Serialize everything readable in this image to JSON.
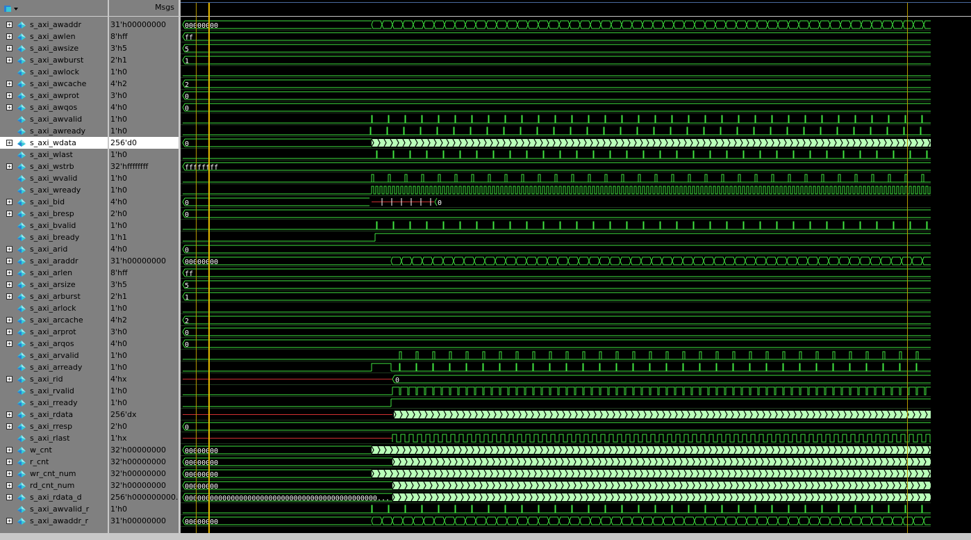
{
  "header": {
    "msgs_label": "Msgs",
    "logo_icon": "wave-window-icon"
  },
  "signals": [
    {
      "name": "s_axi_awaddr",
      "value": "31'h00000000",
      "bus": true,
      "wave": {
        "type": "bus",
        "init": "00000000",
        "activeStart": 535,
        "dense": "medium",
        "color": "#3fe43f"
      }
    },
    {
      "name": "s_axi_awlen",
      "value": "8'hff",
      "bus": true,
      "wave": {
        "type": "const",
        "init": "ff"
      }
    },
    {
      "name": "s_axi_awsize",
      "value": "3'h5",
      "bus": true,
      "wave": {
        "type": "const",
        "init": "5"
      }
    },
    {
      "name": "s_axi_awburst",
      "value": "2'h1",
      "bus": true,
      "wave": {
        "type": "const",
        "init": "1"
      }
    },
    {
      "name": "s_axi_awlock",
      "value": "1'h0",
      "bus": false,
      "wave": {
        "type": "low"
      }
    },
    {
      "name": "s_axi_awcache",
      "value": "4'h2",
      "bus": true,
      "wave": {
        "type": "const",
        "init": "2"
      }
    },
    {
      "name": "s_axi_awprot",
      "value": "3'h0",
      "bus": true,
      "wave": {
        "type": "const",
        "init": "0"
      }
    },
    {
      "name": "s_axi_awqos",
      "value": "4'h0",
      "bus": true,
      "wave": {
        "type": "const",
        "init": "0"
      }
    },
    {
      "name": "s_axi_awvalid",
      "value": "1'h0",
      "bus": false,
      "wave": {
        "type": "pulses",
        "start": 535,
        "period": 24
      }
    },
    {
      "name": "s_axi_awready",
      "value": "1'h0",
      "bus": false,
      "wave": {
        "type": "pulses",
        "start": 533,
        "period": 24
      }
    },
    {
      "name": "s_axi_wdata",
      "value": "256'd0",
      "bus": true,
      "selected": true,
      "wave": {
        "type": "bus",
        "init": "0",
        "activeStart": 535,
        "dense": "heavy",
        "color": "#b9ffb9"
      }
    },
    {
      "name": "s_axi_wlast",
      "value": "1'h0",
      "bus": false,
      "wave": {
        "type": "pulses",
        "start": 542,
        "period": 24
      }
    },
    {
      "name": "s_axi_wstrb",
      "value": "32'hffffffff",
      "bus": true,
      "wave": {
        "type": "const",
        "init": "ffffffff"
      }
    },
    {
      "name": "s_axi_wvalid",
      "value": "1'h0",
      "bus": false,
      "wave": {
        "type": "pulses",
        "start": 535,
        "period": 24,
        "wide": true
      }
    },
    {
      "name": "s_axi_wready",
      "value": "1'h0",
      "bus": false,
      "wave": {
        "type": "clock",
        "start": 535,
        "period": 6
      }
    },
    {
      "name": "s_axi_bid",
      "value": "4'h0",
      "bus": true,
      "wave": {
        "type": "bid",
        "init": "0"
      }
    },
    {
      "name": "s_axi_bresp",
      "value": "2'h0",
      "bus": true,
      "wave": {
        "type": "const",
        "init": "0"
      }
    },
    {
      "name": "s_axi_bvalid",
      "value": "1'h0",
      "bus": false,
      "wave": {
        "type": "pulses",
        "start": 542,
        "period": 24
      }
    },
    {
      "name": "s_axi_bready",
      "value": "1'h1",
      "bus": false,
      "wave": {
        "type": "high"
      }
    },
    {
      "name": "s_axi_arid",
      "value": "4'h0",
      "bus": true,
      "wave": {
        "type": "const",
        "init": "0"
      }
    },
    {
      "name": "s_axi_araddr",
      "value": "31'h00000000",
      "bus": true,
      "wave": {
        "type": "bus",
        "init": "00000000",
        "activeStart": 563,
        "dense": "medium",
        "color": "#3fe43f"
      }
    },
    {
      "name": "s_axi_arlen",
      "value": "8'hff",
      "bus": true,
      "wave": {
        "type": "const",
        "init": "ff"
      }
    },
    {
      "name": "s_axi_arsize",
      "value": "3'h5",
      "bus": true,
      "wave": {
        "type": "const",
        "init": "5"
      }
    },
    {
      "name": "s_axi_arburst",
      "value": "2'h1",
      "bus": true,
      "wave": {
        "type": "const",
        "init": "1"
      }
    },
    {
      "name": "s_axi_arlock",
      "value": "1'h0",
      "bus": false,
      "wave": {
        "type": "low"
      }
    },
    {
      "name": "s_axi_arcache",
      "value": "4'h2",
      "bus": true,
      "wave": {
        "type": "const",
        "init": "2"
      }
    },
    {
      "name": "s_axi_arprot",
      "value": "3'h0",
      "bus": true,
      "wave": {
        "type": "const",
        "init": "0"
      }
    },
    {
      "name": "s_axi_arqos",
      "value": "4'h0",
      "bus": true,
      "wave": {
        "type": "const",
        "init": "0"
      }
    },
    {
      "name": "s_axi_arvalid",
      "value": "1'h0",
      "bus": false,
      "wave": {
        "type": "pulses",
        "start": 575,
        "period": 24,
        "wide": true
      }
    },
    {
      "name": "s_axi_arready",
      "value": "1'h0",
      "bus": false,
      "wave": {
        "type": "arready",
        "start": 575,
        "period": 24
      }
    },
    {
      "name": "s_axi_rid",
      "value": "4'hx",
      "bus": true,
      "wave": {
        "type": "xbus",
        "switch": 565,
        "init": "0"
      }
    },
    {
      "name": "s_axi_rvalid",
      "value": "1'h0",
      "bus": false,
      "wave": {
        "type": "rvalid",
        "start": 565,
        "period": 12
      }
    },
    {
      "name": "s_axi_rready",
      "value": "1'h0",
      "bus": false,
      "wave": {
        "type": "risehigh",
        "start": 563
      }
    },
    {
      "name": "s_axi_rdata",
      "value": "256'dx",
      "bus": true,
      "wave": {
        "type": "xdata",
        "switch": 565
      }
    },
    {
      "name": "s_axi_rresp",
      "value": "2'h0",
      "bus": true,
      "wave": {
        "type": "const",
        "init": "0"
      }
    },
    {
      "name": "s_axi_rlast",
      "value": "1'hx",
      "bus": false,
      "wave": {
        "type": "xclock",
        "switch": 565,
        "period": 12
      }
    },
    {
      "name": "w_cnt",
      "value": "32'h00000000",
      "bus": true,
      "wave": {
        "type": "bus",
        "init": "00000000",
        "activeStart": 535,
        "dense": "heavy",
        "color": "#b9ffb9"
      }
    },
    {
      "name": "r_cnt",
      "value": "32'h00000000",
      "bus": true,
      "wave": {
        "type": "bus",
        "init": "00000000",
        "activeStart": 565,
        "dense": "heavy",
        "color": "#b9ffb9"
      }
    },
    {
      "name": "wr_cnt_num",
      "value": "32'h00000000",
      "bus": true,
      "wave": {
        "type": "bus",
        "init": "00000000",
        "activeStart": 535,
        "dense": "heavy",
        "color": "#b9ffb9"
      }
    },
    {
      "name": "rd_cnt_num",
      "value": "32'h00000000",
      "bus": true,
      "wave": {
        "type": "bus",
        "init": "00000000",
        "activeStart": 565,
        "dense": "heavy",
        "color": "#b9ffb9"
      }
    },
    {
      "name": "s_axi_rdata_d",
      "value": "256'h000000000...",
      "bus": true,
      "wave": {
        "type": "bus",
        "init": "0000000000000000000000000000000000000000000000...",
        "activeStart": 565,
        "dense": "heavy",
        "color": "#b9ffb9"
      }
    },
    {
      "name": "s_axi_awvalid_r",
      "value": "1'h0",
      "bus": false,
      "wave": {
        "type": "pulses",
        "start": 535,
        "period": 24
      }
    },
    {
      "name": "s_axi_awaddr_r",
      "value": "31'h00000000",
      "bus": true,
      "wave": {
        "type": "bus",
        "init": "00000000",
        "activeStart": 535,
        "dense": "medium",
        "color": "#3fe43f"
      }
    }
  ],
  "cursors": {
    "cursor_color": "#e6b800",
    "marker_color": "#b89a00"
  },
  "colors": {
    "wave_green": "#3fe43f",
    "data_fill": "#b9ffb9",
    "x_red": "#d03030",
    "icon_blue": "#2a7fd4",
    "icon_cyan": "#36c8d8"
  }
}
